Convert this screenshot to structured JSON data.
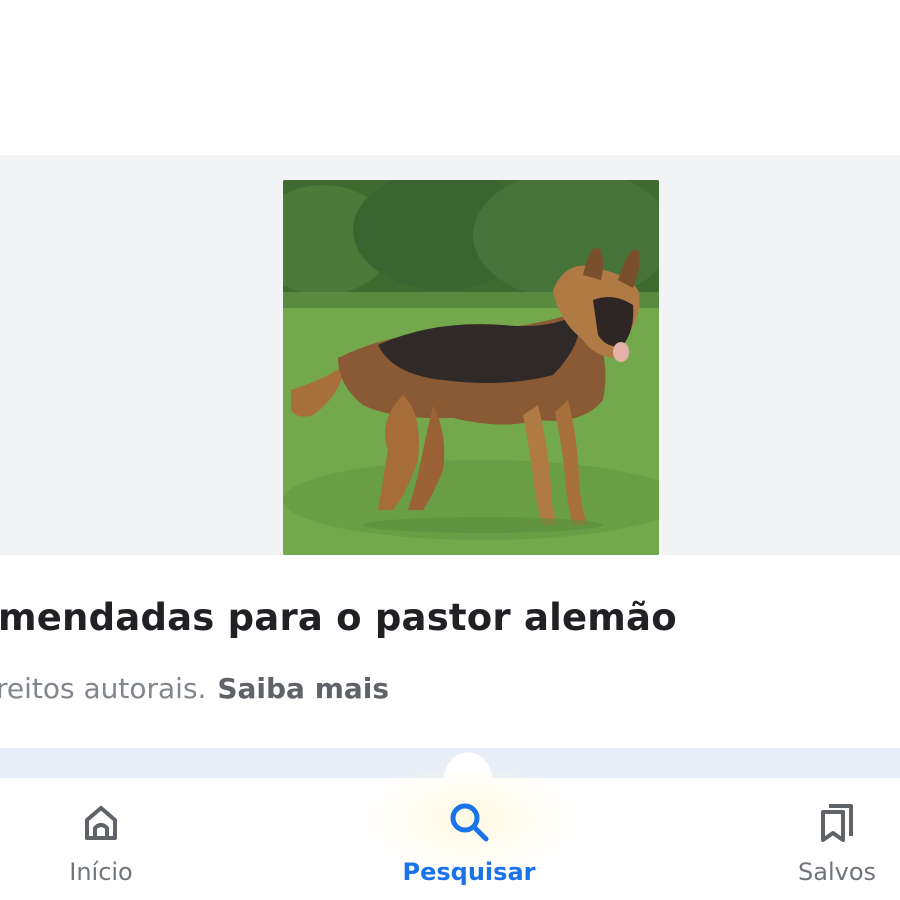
{
  "result": {
    "image_alt": "pastor alemão",
    "title": "mendadas para o pastor alemão",
    "note_text": "reitos autorais.",
    "learn_more": "Saiba mais"
  },
  "bottom_nav": {
    "home_label": "Início",
    "search_label": "Pesquisar",
    "saved_label": "Salvos",
    "active": "search"
  },
  "colors": {
    "accent": "#1a73e8",
    "text_primary": "#202124",
    "text_secondary": "#80868b",
    "panel_bg": "#f1f3f4",
    "strip_bg": "#e8eef8"
  },
  "icons": {
    "home": "home-icon",
    "search": "search-icon",
    "saved": "bookmarks-icon"
  }
}
